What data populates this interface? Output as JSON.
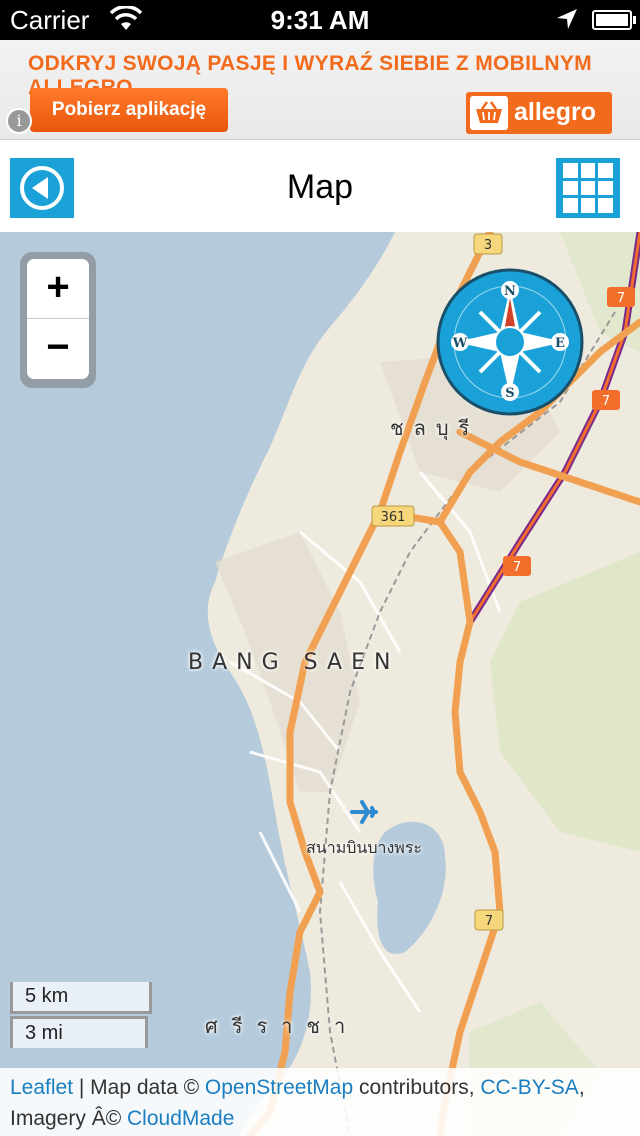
{
  "status_bar": {
    "carrier": "Carrier",
    "time": "9:31 AM",
    "icons": [
      "wifi-icon",
      "location-arrow-icon",
      "battery-icon"
    ]
  },
  "ad_banner": {
    "headline": "ODKRYJ SWOJĄ PASJĘ I WYRAŹ SIEBIE Z MOBILNYM ALLEGRO",
    "cta_label": "Pobierz aplikację",
    "info_label": "i",
    "brand_name": "allegro",
    "accent_color": "#f26b1d"
  },
  "nav_bar": {
    "title": "Map",
    "back_icon": "back-arrow-icon",
    "menu_icon": "grid-menu-icon",
    "accent_color": "#1aa2d8"
  },
  "map": {
    "zoom_in_label": "+",
    "zoom_out_label": "−",
    "compass_labels": {
      "n": "N",
      "e": "E",
      "s": "S",
      "w": "W"
    },
    "places": {
      "bang_saen": "BANG SAEN",
      "chonburi": "ชลบุรี",
      "airfield": "สนามบินบางพระ",
      "sriracha": "ศรีราชา"
    },
    "road_shields": [
      "3",
      "7",
      "7",
      "361",
      "7",
      "7"
    ],
    "scale": {
      "km": "5 km",
      "mi": "3 mi"
    },
    "attribution": {
      "leaflet": "Leaflet",
      "sep1": " | Map data © ",
      "osm": "OpenStreetMap",
      "contributors": " contributors, ",
      "license": "CC-BY-SA",
      "comma": ",",
      "imagery": "Imagery Â© ",
      "cloudmade": "CloudMade"
    }
  }
}
